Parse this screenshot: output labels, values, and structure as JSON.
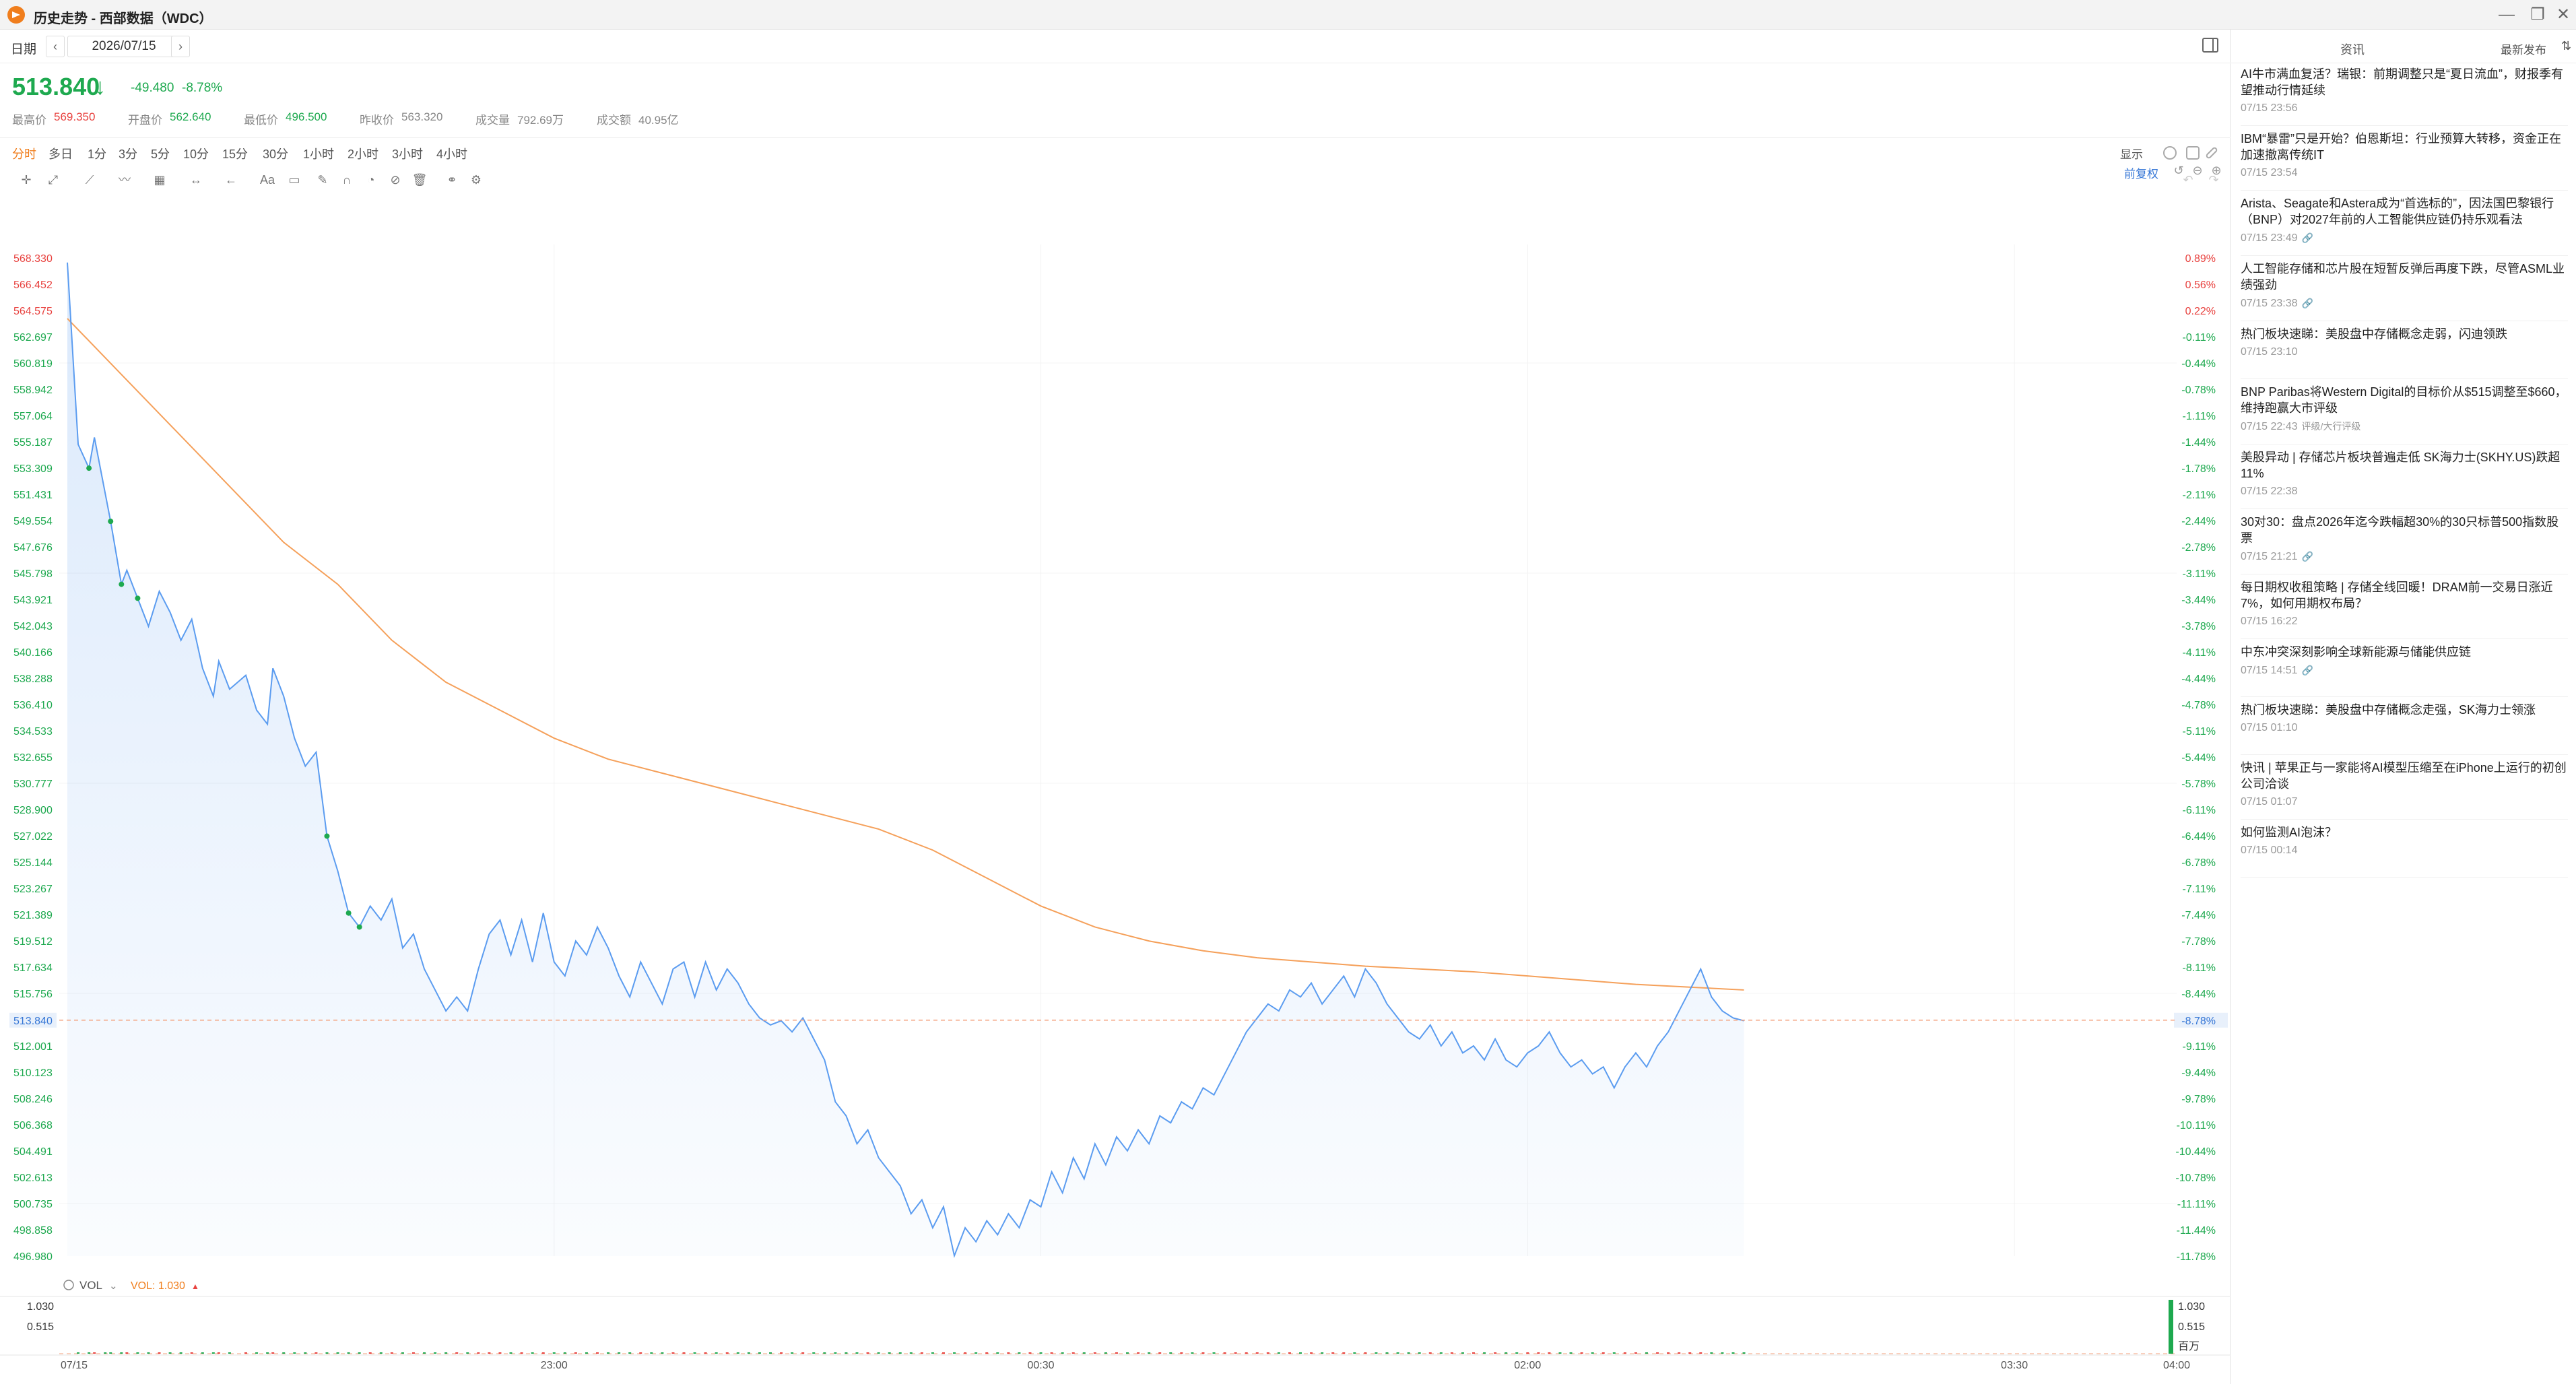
{
  "window": {
    "title": "历史走势 - 西部数据（WDC）",
    "controls": [
      "—",
      "❐",
      "✕"
    ]
  },
  "date_bar": {
    "label": "日期",
    "date": "2026/07/15",
    "prev": "‹",
    "next": "›"
  },
  "quote": {
    "last": "513.840",
    "arrow": "↓",
    "change": "-49.480",
    "change_pct": "-8.78%",
    "stats": [
      {
        "label": "最高价",
        "value": "569.350",
        "color": "#e8423f"
      },
      {
        "label": "开盘价",
        "value": "562.640",
        "color": "#1ea94f"
      },
      {
        "label": "最低价",
        "value": "496.500",
        "color": "#1ea94f"
      },
      {
        "label": "昨收价",
        "value": "563.320",
        "color": "#888888"
      },
      {
        "label": "成交量",
        "value": "792.69万",
        "color": "#888888"
      },
      {
        "label": "成交额",
        "value": "40.95亿",
        "color": "#888888"
      }
    ]
  },
  "timeframes": [
    "分时",
    "多日",
    "1分",
    "3分",
    "5分",
    "10分",
    "15分",
    "30分",
    "1小时",
    "2小时",
    "3小时",
    "4小时"
  ],
  "active_timeframe": "分时",
  "display_button": "显示",
  "adjust_label": "前复权",
  "volume_panel": {
    "indicator": "VOL",
    "value_label": "VOL: 1.030",
    "axis_left": [
      "1.030",
      "0.515"
    ],
    "axis_right": [
      "1.030",
      "0.515",
      "百万"
    ]
  },
  "colors": {
    "up": "#e8423f",
    "down": "#1ea94f",
    "price_line": "#5b9cf0",
    "avg_line": "#f5a05a",
    "accent": "#f07e1d",
    "link": "#3576d6"
  },
  "chart_data": {
    "type": "line",
    "x_tick_labels": [
      "07/15",
      "23:00",
      "00:30",
      "02:00",
      "03:30",
      "04:00"
    ],
    "x_tick_minutes": [
      0,
      90,
      180,
      270,
      360,
      390
    ],
    "y_left_labels": [
      "568.330",
      "566.452",
      "564.575",
      "562.697",
      "560.819",
      "558.942",
      "557.064",
      "555.187",
      "553.309",
      "551.431",
      "549.554",
      "547.676",
      "545.798",
      "543.921",
      "542.043",
      "540.166",
      "538.288",
      "536.410",
      "534.533",
      "532.655",
      "530.777",
      "528.900",
      "527.022",
      "525.144",
      "523.267",
      "521.389",
      "519.512",
      "517.634",
      "515.756",
      "513.840",
      "512.001",
      "510.123",
      "508.246",
      "506.368",
      "504.491",
      "502.613",
      "500.735",
      "498.858",
      "496.980"
    ],
    "y_right_labels": [
      "0.89%",
      "0.56%",
      "0.22%",
      "-0.11%",
      "-0.44%",
      "-0.78%",
      "-1.11%",
      "-1.44%",
      "-1.78%",
      "-2.11%",
      "-2.44%",
      "-2.78%",
      "-3.11%",
      "-3.44%",
      "-3.78%",
      "-4.11%",
      "-4.44%",
      "-4.78%",
      "-5.11%",
      "-5.44%",
      "-5.78%",
      "-6.11%",
      "-6.44%",
      "-6.78%",
      "-7.11%",
      "-7.44%",
      "-7.78%",
      "-8.11%",
      "-8.44%",
      "-8.78%",
      "-9.11%",
      "-9.44%",
      "-9.78%",
      "-10.11%",
      "-10.44%",
      "-10.78%",
      "-11.11%",
      "-11.44%",
      "-11.78%"
    ],
    "ylim": [
      496.98,
      568.33
    ],
    "current_price": 513.84,
    "series": [
      {
        "role": "price",
        "points": [
          [
            0,
            568.0
          ],
          [
            2,
            555.0
          ],
          [
            4,
            553.3
          ],
          [
            5,
            555.5
          ],
          [
            7,
            551.5
          ],
          [
            8,
            549.5
          ],
          [
            10,
            545.0
          ],
          [
            11,
            546.0
          ],
          [
            13,
            544.0
          ],
          [
            15,
            542.0
          ],
          [
            17,
            544.5
          ],
          [
            19,
            543.0
          ],
          [
            21,
            541.0
          ],
          [
            23,
            542.5
          ],
          [
            25,
            539.0
          ],
          [
            27,
            537.0
          ],
          [
            28,
            539.5
          ],
          [
            30,
            537.5
          ],
          [
            33,
            538.5
          ],
          [
            35,
            536.0
          ],
          [
            37,
            535.0
          ],
          [
            38,
            539.0
          ],
          [
            40,
            537.0
          ],
          [
            42,
            534.0
          ],
          [
            44,
            532.0
          ],
          [
            46,
            533.0
          ],
          [
            48,
            527.0
          ],
          [
            50,
            524.5
          ],
          [
            52,
            521.5
          ],
          [
            54,
            520.5
          ],
          [
            56,
            522.0
          ],
          [
            58,
            521.0
          ],
          [
            60,
            522.5
          ],
          [
            62,
            519.0
          ],
          [
            64,
            520.0
          ],
          [
            66,
            517.5
          ],
          [
            68,
            516.0
          ],
          [
            70,
            514.5
          ],
          [
            72,
            515.5
          ],
          [
            74,
            514.5
          ],
          [
            76,
            517.5
          ],
          [
            78,
            520.0
          ],
          [
            80,
            521.0
          ],
          [
            82,
            518.5
          ],
          [
            84,
            521.0
          ],
          [
            86,
            518.0
          ],
          [
            88,
            521.5
          ],
          [
            90,
            518.0
          ],
          [
            92,
            517.0
          ],
          [
            94,
            519.5
          ],
          [
            96,
            518.5
          ],
          [
            98,
            520.5
          ],
          [
            100,
            519.0
          ],
          [
            102,
            517.0
          ],
          [
            104,
            515.5
          ],
          [
            106,
            518.0
          ],
          [
            108,
            516.5
          ],
          [
            110,
            515.0
          ],
          [
            112,
            517.5
          ],
          [
            114,
            518.0
          ],
          [
            116,
            515.5
          ],
          [
            118,
            518.0
          ],
          [
            120,
            516.0
          ],
          [
            122,
            517.5
          ],
          [
            124,
            516.5
          ],
          [
            126,
            515.0
          ],
          [
            128,
            514.0
          ],
          [
            130,
            513.5
          ],
          [
            132,
            513.8
          ],
          [
            134,
            513.0
          ],
          [
            136,
            514.0
          ],
          [
            138,
            512.5
          ],
          [
            140,
            511.0
          ],
          [
            142,
            508.0
          ],
          [
            144,
            507.0
          ],
          [
            146,
            505.0
          ],
          [
            148,
            506.0
          ],
          [
            150,
            504.0
          ],
          [
            152,
            503.0
          ],
          [
            154,
            502.0
          ],
          [
            156,
            500.0
          ],
          [
            158,
            501.0
          ],
          [
            160,
            499.0
          ],
          [
            162,
            500.5
          ],
          [
            164,
            497.0
          ],
          [
            166,
            499.0
          ],
          [
            168,
            498.0
          ],
          [
            170,
            499.5
          ],
          [
            172,
            498.5
          ],
          [
            174,
            500.0
          ],
          [
            176,
            499.0
          ],
          [
            178,
            501.0
          ],
          [
            180,
            500.5
          ],
          [
            182,
            503.0
          ],
          [
            184,
            501.5
          ],
          [
            186,
            504.0
          ],
          [
            188,
            502.5
          ],
          [
            190,
            505.0
          ],
          [
            192,
            503.5
          ],
          [
            194,
            505.5
          ],
          [
            196,
            504.5
          ],
          [
            198,
            506.0
          ],
          [
            200,
            505.0
          ],
          [
            202,
            507.0
          ],
          [
            204,
            506.5
          ],
          [
            206,
            508.0
          ],
          [
            208,
            507.5
          ],
          [
            210,
            509.0
          ],
          [
            212,
            508.5
          ],
          [
            214,
            510.0
          ],
          [
            216,
            511.5
          ],
          [
            218,
            513.0
          ],
          [
            220,
            514.0
          ],
          [
            222,
            515.0
          ],
          [
            224,
            514.5
          ],
          [
            226,
            516.0
          ],
          [
            228,
            515.5
          ],
          [
            230,
            516.5
          ],
          [
            232,
            515.0
          ],
          [
            234,
            516.0
          ],
          [
            236,
            517.0
          ],
          [
            238,
            515.5
          ],
          [
            240,
            517.5
          ],
          [
            242,
            516.5
          ],
          [
            244,
            515.0
          ],
          [
            246,
            514.0
          ],
          [
            248,
            513.0
          ],
          [
            250,
            512.5
          ],
          [
            252,
            513.5
          ],
          [
            254,
            512.0
          ],
          [
            256,
            513.0
          ],
          [
            258,
            511.5
          ],
          [
            260,
            512.0
          ],
          [
            262,
            511.0
          ],
          [
            264,
            512.5
          ],
          [
            266,
            511.0
          ],
          [
            268,
            510.5
          ],
          [
            270,
            511.5
          ],
          [
            272,
            512.0
          ],
          [
            274,
            513.0
          ],
          [
            276,
            511.5
          ],
          [
            278,
            510.5
          ],
          [
            280,
            511.0
          ],
          [
            282,
            510.0
          ],
          [
            284,
            510.5
          ],
          [
            286,
            509.0
          ],
          [
            288,
            510.5
          ],
          [
            290,
            511.5
          ],
          [
            292,
            510.5
          ],
          [
            294,
            512.0
          ],
          [
            296,
            513.0
          ],
          [
            298,
            514.5
          ],
          [
            300,
            516.0
          ],
          [
            302,
            517.5
          ],
          [
            304,
            515.5
          ],
          [
            306,
            514.5
          ],
          [
            308,
            514.0
          ],
          [
            310,
            513.8
          ]
        ]
      },
      {
        "role": "average",
        "points": [
          [
            0,
            564.0
          ],
          [
            10,
            560.0
          ],
          [
            20,
            556.0
          ],
          [
            30,
            552.0
          ],
          [
            40,
            548.0
          ],
          [
            50,
            545.0
          ],
          [
            60,
            541.0
          ],
          [
            70,
            538.0
          ],
          [
            80,
            536.0
          ],
          [
            90,
            534.0
          ],
          [
            100,
            532.5
          ],
          [
            110,
            531.5
          ],
          [
            120,
            530.5
          ],
          [
            130,
            529.5
          ],
          [
            140,
            528.5
          ],
          [
            150,
            527.5
          ],
          [
            160,
            526.0
          ],
          [
            170,
            524.0
          ],
          [
            180,
            522.0
          ],
          [
            190,
            520.5
          ],
          [
            200,
            519.5
          ],
          [
            210,
            518.8
          ],
          [
            220,
            518.3
          ],
          [
            230,
            518.0
          ],
          [
            240,
            517.7
          ],
          [
            250,
            517.5
          ],
          [
            260,
            517.3
          ],
          [
            270,
            517.0
          ],
          [
            280,
            516.7
          ],
          [
            290,
            516.4
          ],
          [
            300,
            516.2
          ],
          [
            310,
            516.0
          ]
        ]
      }
    ],
    "volume": {
      "ylim": [
        0,
        1.03
      ]
    }
  },
  "news": {
    "tab": "资讯",
    "sort": "最新发布",
    "sort_icon": "⇅",
    "items": [
      {
        "title": "AI牛市满血复活？瑞银：前期调整只是“夏日流血”，财报季有望推动行情延续",
        "time": "07/15 23:56",
        "tag": ""
      },
      {
        "title": "IBM“暴雷”只是开始？伯恩斯坦：行业预算大转移，资金正在加速撤离传统IT",
        "time": "07/15 23:54",
        "tag": ""
      },
      {
        "title": "Arista、Seagate和Astera成为“首选标的”，因法国巴黎银行（BNP）对2027年前的人工智能供应链仍持乐观看法",
        "time": "07/15 23:49",
        "tag": "🔗"
      },
      {
        "title": "人工智能存储和芯片股在短暂反弹后再度下跌，尽管ASML业绩强劲",
        "time": "07/15 23:38",
        "tag": "🔗"
      },
      {
        "title": "热门板块速睇：美股盘中存储概念走弱，闪迪领跌",
        "time": "07/15 23:10",
        "tag": ""
      },
      {
        "title": "BNP Paribas将Western Digital的目标价从$515调整至$660，维持跑赢大市评级",
        "time": "07/15 22:43",
        "tag": "评级/大行评级"
      },
      {
        "title": "美股异动 | 存储芯片板块普遍走低 SK海力士(SKHY.US)跌超11%",
        "time": "07/15 22:38",
        "tag": ""
      },
      {
        "title": "30对30：盘点2026年迄今跌幅超30%的30只标普500指数股票",
        "time": "07/15 21:21",
        "tag": "🔗"
      },
      {
        "title": "每日期权收租策略 | 存储全线回暖！DRAM前一交易日涨近7%，如何用期权布局？",
        "time": "07/15 16:22",
        "tag": ""
      },
      {
        "title": "中东冲突深刻影响全球新能源与储能供应链",
        "time": "07/15 14:51",
        "tag": "🔗"
      },
      {
        "title": "热门板块速睇：美股盘中存储概念走强，SK海力士领涨",
        "time": "07/15 01:10",
        "tag": ""
      },
      {
        "title": "快讯 | 苹果正与一家能将AI模型压缩至在iPhone上运行的初创公司洽谈",
        "time": "07/15 01:07",
        "tag": ""
      },
      {
        "title": "如何监测AI泡沫？",
        "time": "07/15 00:14",
        "tag": ""
      }
    ]
  }
}
